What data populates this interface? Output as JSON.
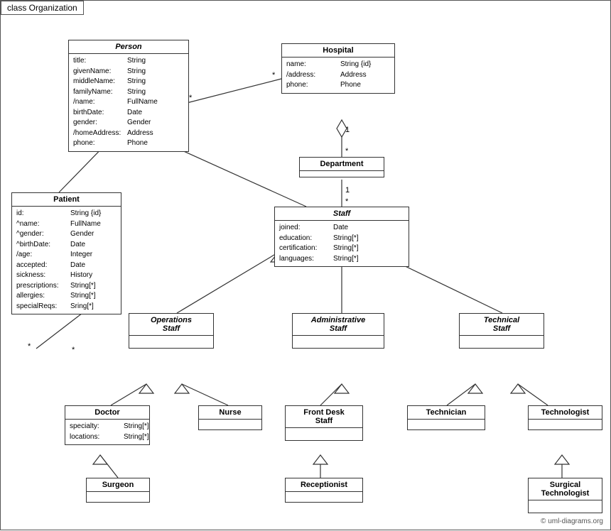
{
  "title": "class Organization",
  "classes": {
    "person": {
      "name": "Person",
      "italic": true,
      "attrs": [
        {
          "name": "title:",
          "type": "String"
        },
        {
          "name": "givenName:",
          "type": "String"
        },
        {
          "name": "middleName:",
          "type": "String"
        },
        {
          "name": "familyName:",
          "type": "String"
        },
        {
          "name": "/name:",
          "type": "FullName"
        },
        {
          "name": "birthDate:",
          "type": "Date"
        },
        {
          "name": "gender:",
          "type": "Gender"
        },
        {
          "name": "/homeAddress:",
          "type": "Address"
        },
        {
          "name": "phone:",
          "type": "Phone"
        }
      ]
    },
    "hospital": {
      "name": "Hospital",
      "italic": false,
      "attrs": [
        {
          "name": "name:",
          "type": "String {id}"
        },
        {
          "name": "/address:",
          "type": "Address"
        },
        {
          "name": "phone:",
          "type": "Phone"
        }
      ]
    },
    "department": {
      "name": "Department",
      "italic": false,
      "attrs": []
    },
    "staff": {
      "name": "Staff",
      "italic": true,
      "attrs": [
        {
          "name": "joined:",
          "type": "Date"
        },
        {
          "name": "education:",
          "type": "String[*]"
        },
        {
          "name": "certification:",
          "type": "String[*]"
        },
        {
          "name": "languages:",
          "type": "String[*]"
        }
      ]
    },
    "patient": {
      "name": "Patient",
      "italic": false,
      "attrs": [
        {
          "name": "id:",
          "type": "String {id}"
        },
        {
          "name": "^name:",
          "type": "FullName"
        },
        {
          "name": "^gender:",
          "type": "Gender"
        },
        {
          "name": "^birthDate:",
          "type": "Date"
        },
        {
          "name": "/age:",
          "type": "Integer"
        },
        {
          "name": "accepted:",
          "type": "Date"
        },
        {
          "name": "sickness:",
          "type": "History"
        },
        {
          "name": "prescriptions:",
          "type": "String[*]"
        },
        {
          "name": "allergies:",
          "type": "String[*]"
        },
        {
          "name": "specialReqs:",
          "type": "Sring[*]"
        }
      ]
    },
    "operations_staff": {
      "name": "Operations\nStaff",
      "italic": true,
      "attrs": []
    },
    "administrative_staff": {
      "name": "Administrative\nStaff",
      "italic": true,
      "attrs": []
    },
    "technical_staff": {
      "name": "Technical\nStaff",
      "italic": true,
      "attrs": []
    },
    "doctor": {
      "name": "Doctor",
      "italic": false,
      "attrs": [
        {
          "name": "specialty:",
          "type": "String[*]"
        },
        {
          "name": "locations:",
          "type": "String[*]"
        }
      ]
    },
    "nurse": {
      "name": "Nurse",
      "italic": false,
      "attrs": []
    },
    "front_desk_staff": {
      "name": "Front Desk\nStaff",
      "italic": false,
      "attrs": []
    },
    "technician": {
      "name": "Technician",
      "italic": false,
      "attrs": []
    },
    "technologist": {
      "name": "Technologist",
      "italic": false,
      "attrs": []
    },
    "surgeon": {
      "name": "Surgeon",
      "italic": false,
      "attrs": []
    },
    "receptionist": {
      "name": "Receptionist",
      "italic": false,
      "attrs": []
    },
    "surgical_technologist": {
      "name": "Surgical\nTechnologist",
      "italic": false,
      "attrs": []
    }
  },
  "copyright": "© uml-diagrams.org"
}
